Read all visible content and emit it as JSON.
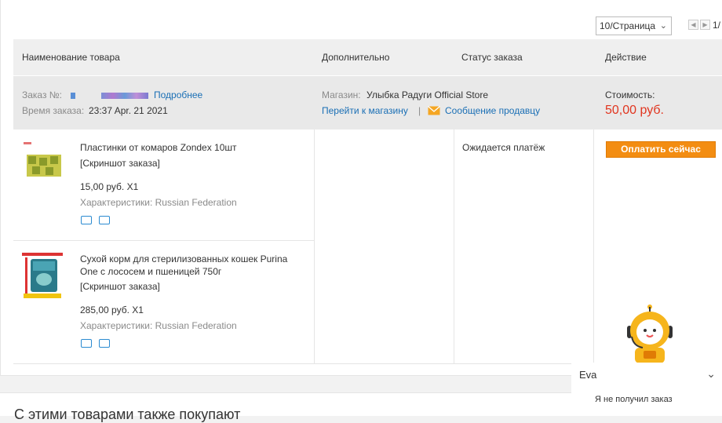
{
  "pager": {
    "per_page": "10/Страница",
    "page_indicator": "1/"
  },
  "table_header": {
    "product_name": "Наименование товара",
    "additional": "Дополнительно",
    "order_status": "Статус заказа",
    "action": "Действие"
  },
  "order": {
    "number_label": "Заказ №:",
    "details_link": "Подробнее",
    "time_label": "Время заказа:",
    "time_value": "23:37 Apr. 21 2021",
    "store_label": "Магазин:",
    "store_name": "Улыбка Радуги Official Store",
    "go_to_store": "Перейти к магазину",
    "separator": "|",
    "message_seller": "Сообщение продавцу",
    "cost_label": "Стоимость:",
    "cost_value": "50,00 руб.",
    "status": "Ожидается платёж",
    "pay_button": "Оплатить сейчас"
  },
  "products": [
    {
      "title": "Пластинки от комаров Zondex 10шт",
      "title_line2": "",
      "snapshot": "[Скриншот заказа]",
      "price": "15,00 руб. X1",
      "characteristics": "Характеристики: Russian Federation"
    },
    {
      "title": "Сухой корм для стерилизованных кошек Purina",
      "title_line2": "One с лососем и пшеницей 750г",
      "snapshot": "[Скриншот заказа]",
      "price": "285,00 руб. X1",
      "characteristics": "Характеристики: Russian Federation"
    }
  ],
  "also_bought": "С этими товарами также покупают",
  "chat": {
    "name": "Eva",
    "message": "Я не получил заказ"
  },
  "colors": {
    "link": "#1a6fb5",
    "price": "#e1351f",
    "pay_button": "#f38d12",
    "icon": "#2b8bd1"
  },
  "icons": [
    "chevron-down-icon",
    "prev-page-icon",
    "next-page-icon",
    "envelope-icon",
    "delivery-truck-icon",
    "return-icon",
    "robot-assistant-icon"
  ]
}
